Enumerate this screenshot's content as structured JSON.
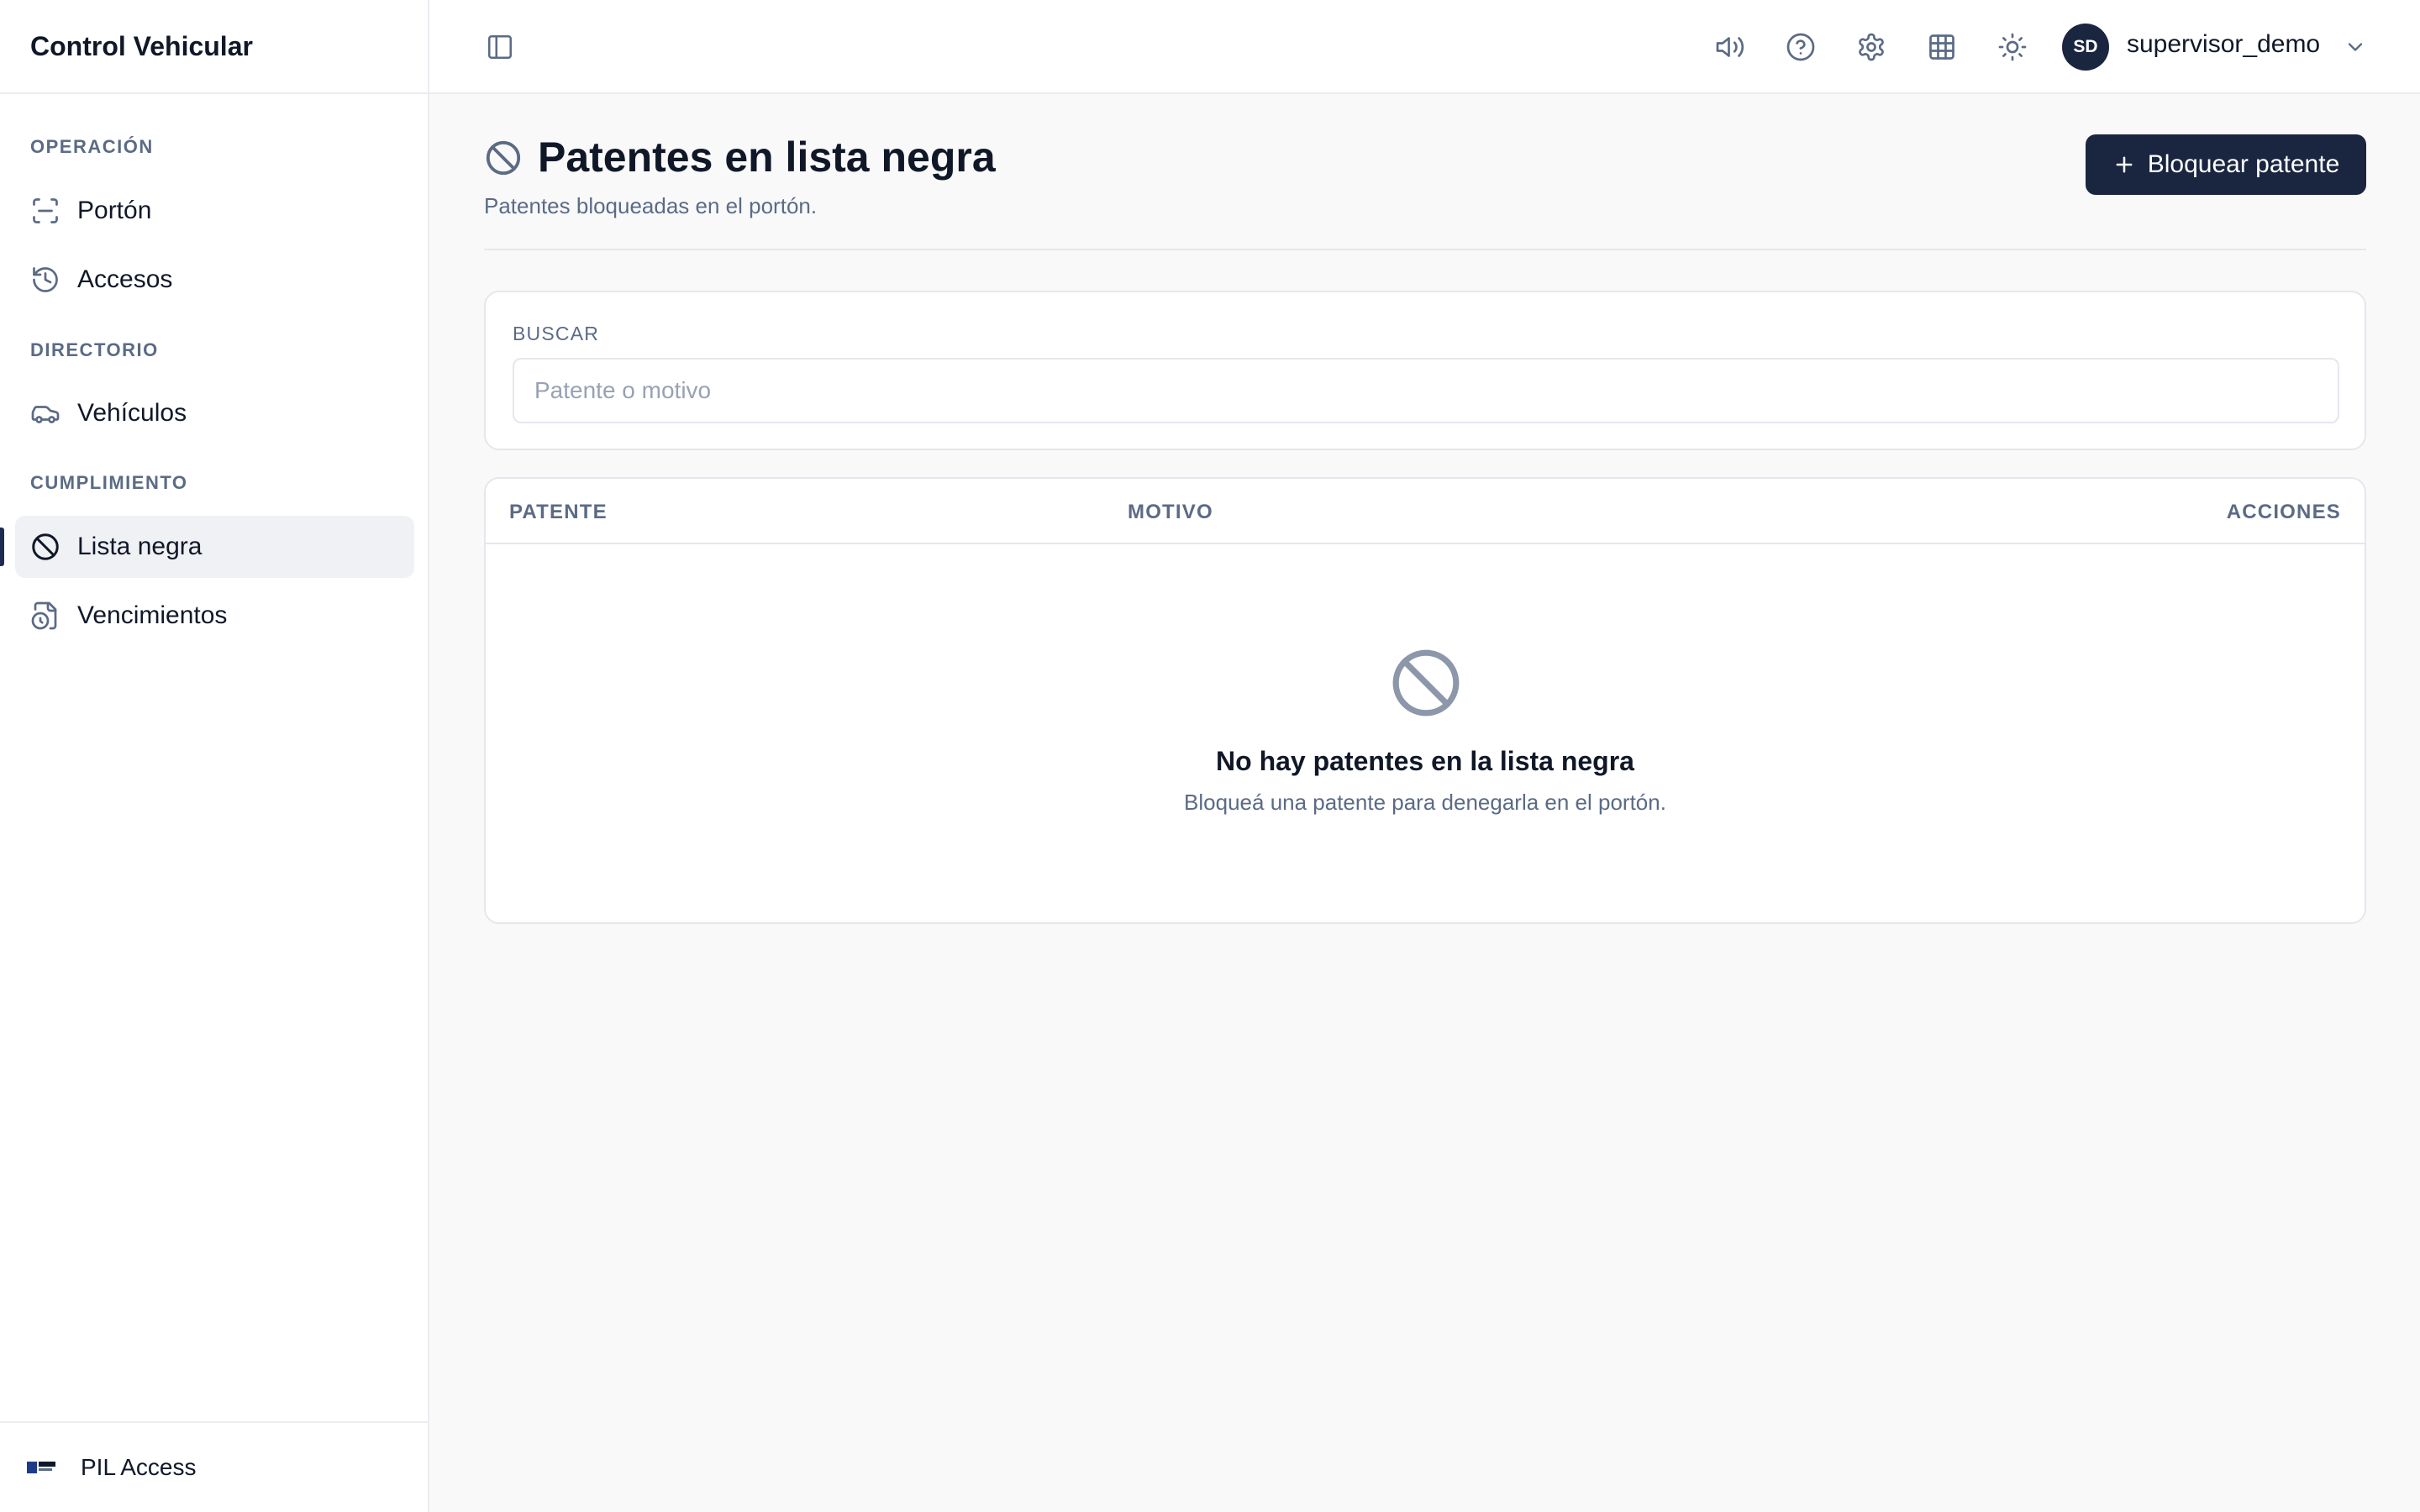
{
  "app": {
    "title": "Control Vehicular",
    "footer_label": "PIL Access"
  },
  "sidebar": {
    "sections": [
      {
        "label": "OPERACIÓN",
        "items": [
          {
            "label": "Portón",
            "icon": "scan-icon"
          },
          {
            "label": "Accesos",
            "icon": "history-icon"
          }
        ]
      },
      {
        "label": "DIRECTORIO",
        "items": [
          {
            "label": "Vehículos",
            "icon": "car-icon"
          }
        ]
      },
      {
        "label": "CUMPLIMIENTO",
        "items": [
          {
            "label": "Lista negra",
            "icon": "ban-icon",
            "active": true
          },
          {
            "label": "Vencimientos",
            "icon": "file-clock-icon"
          }
        ]
      }
    ]
  },
  "topbar": {
    "icons": [
      "sidebar-toggle-icon",
      "speaker-icon",
      "help-icon",
      "settings-icon",
      "grid-icon",
      "sun-icon"
    ],
    "user": {
      "initials": "SD",
      "name": "supervisor_demo"
    }
  },
  "page": {
    "title": "Patentes en lista negra",
    "subtitle": "Patentes bloqueadas en el portón.",
    "primary_button": "Bloquear patente"
  },
  "search": {
    "label": "BUSCAR",
    "placeholder": "Patente o motivo",
    "value": ""
  },
  "table": {
    "columns": [
      "PATENTE",
      "MOTIVO",
      "ACCIONES"
    ],
    "rows": [],
    "empty_title": "No hay patentes en la lista negra",
    "empty_subtitle": "Bloqueá una patente para denegarla en el portón."
  },
  "colors": {
    "primary": "#1a2540",
    "muted": "#5b6b85",
    "border": "#e4e7ec",
    "active_bg": "#f0f1f4"
  }
}
